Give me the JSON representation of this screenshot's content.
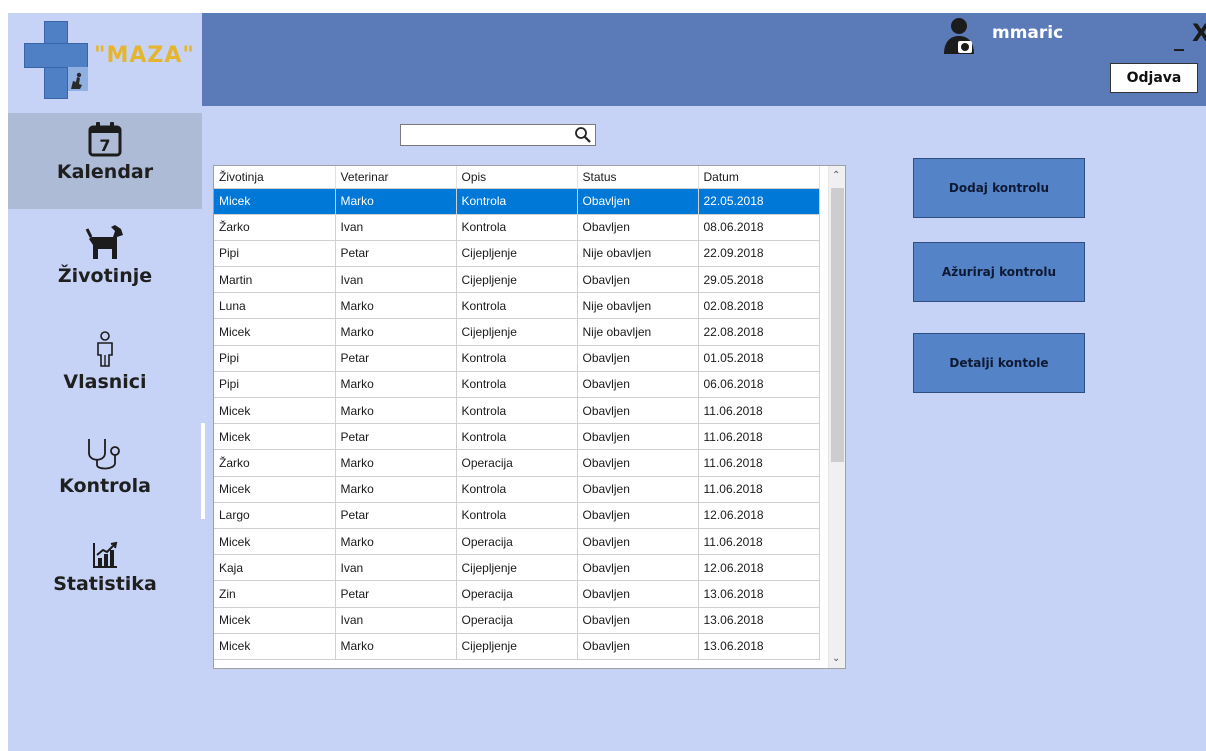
{
  "app": {
    "logo_text": "\"MAZA\""
  },
  "header": {
    "username": "mmaric",
    "minimize_label": "_",
    "close_label": "X",
    "logout_label": "Odjava"
  },
  "sidebar": {
    "items": [
      {
        "label": "Kalendar",
        "icon": "calendar-icon",
        "calendar_day": "7",
        "active": true
      },
      {
        "label": "Životinje",
        "icon": "dog-icon",
        "active": false
      },
      {
        "label": "Vlasnici",
        "icon": "person-icon",
        "active": false
      },
      {
        "label": "Kontrola",
        "icon": "stethoscope-icon",
        "active": false
      },
      {
        "label": "Statistika",
        "icon": "chart-icon",
        "active": false
      }
    ]
  },
  "search": {
    "value": "",
    "icon": "search-icon"
  },
  "table": {
    "columns": [
      "Životinja",
      "Veterinar",
      "Opis",
      "Status",
      "Datum"
    ],
    "selected_row": 0,
    "rows": [
      [
        "Micek",
        "Marko",
        "Kontrola",
        "Obavljen",
        "22.05.2018"
      ],
      [
        "Žarko",
        "Ivan",
        "Kontrola",
        "Obavljen",
        "08.06.2018"
      ],
      [
        "Pipi",
        "Petar",
        "Cijepljenje",
        "Nije obavljen",
        "22.09.2018"
      ],
      [
        "Martin",
        "Ivan",
        "Cijepljenje",
        "Obavljen",
        "29.05.2018"
      ],
      [
        "Luna",
        "Marko",
        "Kontrola",
        "Nije obavljen",
        "02.08.2018"
      ],
      [
        "Micek",
        "Marko",
        "Cijepljenje",
        "Nije obavljen",
        "22.08.2018"
      ],
      [
        "Pipi",
        "Petar",
        "Kontrola",
        "Obavljen",
        "01.05.2018"
      ],
      [
        "Pipi",
        "Marko",
        "Kontrola",
        "Obavljen",
        "06.06.2018"
      ],
      [
        "Micek",
        "Marko",
        "Kontrola",
        "Obavljen",
        "11.06.2018"
      ],
      [
        "Micek",
        "Petar",
        "Kontrola",
        "Obavljen",
        "11.06.2018"
      ],
      [
        "Žarko",
        "Marko",
        "Operacija",
        "Obavljen",
        "11.06.2018"
      ],
      [
        "Micek",
        "Marko",
        "Kontrola",
        "Obavljen",
        "11.06.2018"
      ],
      [
        "Largo",
        "Petar",
        "Kontrola",
        "Obavljen",
        "12.06.2018"
      ],
      [
        "Micek",
        "Marko",
        "Operacija",
        "Obavljen",
        "11.06.2018"
      ],
      [
        "Kaja",
        "Ivan",
        "Cijepljenje",
        "Obavljen",
        "12.06.2018"
      ],
      [
        "Zin",
        "Petar",
        "Operacija",
        "Obavljen",
        "13.06.2018"
      ],
      [
        "Micek",
        "Ivan",
        "Operacija",
        "Obavljen",
        "13.06.2018"
      ],
      [
        "Micek",
        "Marko",
        "Cijepljenje",
        "Obavljen",
        "13.06.2018"
      ]
    ]
  },
  "actions": {
    "add_label": "Dodaj kontrolu",
    "update_label": "Ažuriraj kontrolu",
    "details_label": "Detalji kontole"
  },
  "colors": {
    "background": "#c6d3f6",
    "topbar": "#5b7ab8",
    "button": "#5483c8",
    "selection": "#0078d7",
    "sidebar_active": "#aebbd7",
    "logo_text": "#e5b52c"
  }
}
